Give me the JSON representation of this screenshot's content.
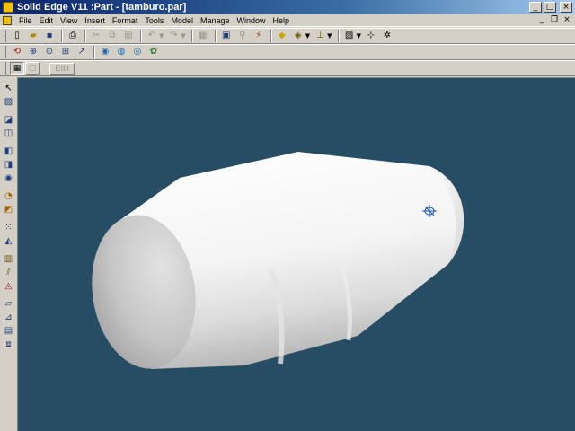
{
  "window": {
    "title": "Solid Edge V11 :Part - [tamburo.par]",
    "controls": [
      "_",
      "□",
      "×"
    ]
  },
  "menubar": {
    "items": [
      "File",
      "Edit",
      "View",
      "Insert",
      "Format",
      "Tools",
      "Model",
      "Manage",
      "Window",
      "Help"
    ],
    "doc_controls": [
      "_",
      "❐",
      "×"
    ]
  },
  "toolbar_main": {
    "buttons": [
      {
        "icon": "new-document-icon",
        "glyph": "▯"
      },
      {
        "icon": "open-folder-icon",
        "glyph": "▰"
      },
      {
        "icon": "save-icon",
        "glyph": "▪"
      },
      {
        "icon": "print-icon",
        "glyph": "⎙"
      },
      {
        "icon": "cut-icon",
        "glyph": "✂"
      },
      {
        "icon": "copy-icon",
        "glyph": "⧉"
      },
      {
        "icon": "paste-icon",
        "glyph": "▤"
      },
      {
        "icon": "undo-icon",
        "glyph": "↶"
      },
      {
        "icon": "redo-icon",
        "glyph": "↷"
      },
      {
        "icon": "paste-special-icon",
        "glyph": "▦"
      },
      {
        "icon": "save-as-icon",
        "glyph": "▣"
      },
      {
        "icon": "hyperlink-icon",
        "glyph": "⚲"
      },
      {
        "icon": "smart-select-icon",
        "glyph": "⚡"
      },
      {
        "icon": "light-bulb-icon",
        "glyph": "◆"
      },
      {
        "icon": "measure-icon",
        "glyph": "◈"
      },
      {
        "icon": "units-icon",
        "glyph": "⊥"
      },
      {
        "icon": "view-icon",
        "glyph": "▧"
      },
      {
        "icon": "coordinate-system-icon",
        "glyph": "⊹"
      },
      {
        "icon": "snap-icon",
        "glyph": "✲"
      }
    ]
  },
  "toolbar_view": {
    "buttons": [
      {
        "icon": "rotate-icon",
        "glyph": "⟲"
      },
      {
        "icon": "zoom-area-icon",
        "glyph": "⊕"
      },
      {
        "icon": "zoom-icon",
        "glyph": "⊙"
      },
      {
        "icon": "fit-icon",
        "glyph": "⊞"
      },
      {
        "icon": "pan-icon",
        "glyph": "↗"
      },
      {
        "icon": "shaded-icon",
        "glyph": "◉"
      },
      {
        "icon": "shaded-edges-icon",
        "glyph": "◍"
      },
      {
        "icon": "wireframe-icon",
        "glyph": "◎"
      },
      {
        "icon": "render-icon",
        "glyph": "✿"
      }
    ]
  },
  "ribbon": {
    "mode_buttons": [
      "▦",
      "▢"
    ],
    "edit_label": "Edit"
  },
  "feature_toolbar": {
    "buttons": [
      {
        "icon": "select-tool-icon",
        "glyph": "↖"
      },
      {
        "icon": "sketch-icon",
        "glyph": "▨"
      },
      {
        "icon": "protrusion-icon",
        "glyph": "◪"
      },
      {
        "icon": "revolved-protrusion-icon",
        "glyph": "◫"
      },
      {
        "icon": "cutout-icon",
        "glyph": "◧"
      },
      {
        "icon": "revolved-cutout-icon",
        "glyph": "◨"
      },
      {
        "icon": "hole-icon",
        "glyph": "◉"
      },
      {
        "icon": "round-icon",
        "glyph": "◔"
      },
      {
        "icon": "chamfer-icon",
        "glyph": "◩"
      },
      {
        "icon": "pattern-icon",
        "glyph": "⁙"
      },
      {
        "icon": "mirror-icon",
        "glyph": "◭"
      },
      {
        "icon": "thin-wall-icon",
        "glyph": "▥"
      },
      {
        "icon": "rib-icon",
        "glyph": "⫽"
      },
      {
        "icon": "draft-icon",
        "glyph": "◬"
      },
      {
        "icon": "plane-icon",
        "glyph": "▱"
      },
      {
        "icon": "axis-icon",
        "glyph": "⊿"
      },
      {
        "icon": "construction-icon",
        "glyph": "▤"
      },
      {
        "icon": "part-copy-icon",
        "glyph": "⧈"
      }
    ]
  },
  "colors": {
    "viewport_bg": "#264d63",
    "part_highlight": "#ffffff",
    "part_shadow": "#9f9f9f",
    "csys_marker": "#1e4fb5"
  }
}
